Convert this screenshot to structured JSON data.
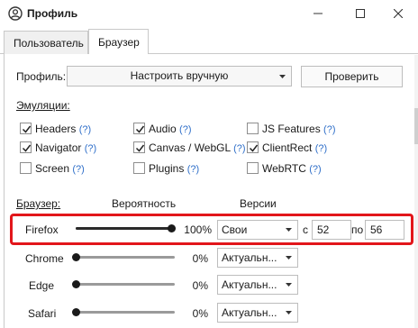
{
  "window": {
    "title": "Профиль",
    "controls": {
      "minimize": "minimize-icon",
      "maximize": "maximize-icon",
      "close": "close-icon"
    },
    "title_icon": "user-circle-icon"
  },
  "tabs": [
    {
      "label": "Пользователь",
      "active": false
    },
    {
      "label": "Браузер",
      "active": true
    }
  ],
  "profile": {
    "label": "Профиль:",
    "selected": "Настроить вручную",
    "check_button": "Проверить"
  },
  "emulation": {
    "label": "Эмуляции:",
    "help": "(?)",
    "items": [
      {
        "label": "Headers",
        "checked": true
      },
      {
        "label": "Navigator",
        "checked": true
      },
      {
        "label": "Screen",
        "checked": false
      },
      {
        "label": "Audio",
        "checked": true
      },
      {
        "label": "Canvas / WebGL",
        "checked": true
      },
      {
        "label": "Plugins",
        "checked": false
      },
      {
        "label": "JS Features",
        "checked": false
      },
      {
        "label": "ClientRect",
        "checked": true
      },
      {
        "label": "WebRTC",
        "checked": false
      }
    ]
  },
  "browsers": {
    "label": "Браузер:",
    "probability_header": "Вероятность",
    "versions_header": "Версии",
    "from_label": "с",
    "to_label": "по",
    "rows": [
      {
        "name": "Firefox",
        "percent": "100%",
        "value": 100,
        "version_mode": "Свои",
        "from": "52",
        "to": "56"
      },
      {
        "name": "Chrome",
        "percent": "0%",
        "value": 0,
        "version_mode": "Актуальн..."
      },
      {
        "name": "Edge",
        "percent": "0%",
        "value": 0,
        "version_mode": "Актуальн..."
      },
      {
        "name": "Safari",
        "percent": "0%",
        "value": 0,
        "version_mode": "Актуальн..."
      }
    ]
  },
  "colors": {
    "highlight": "#e2161b",
    "help_link": "#2f6fc9"
  }
}
